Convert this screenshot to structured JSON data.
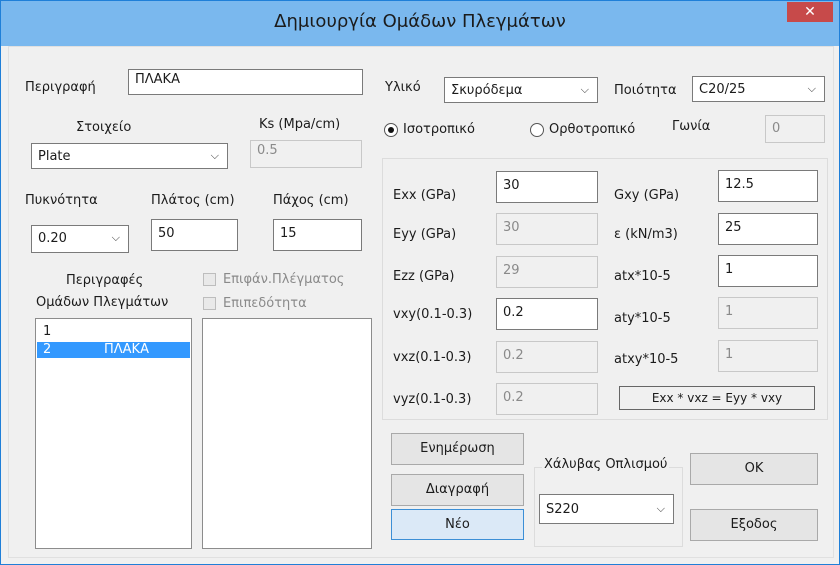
{
  "window": {
    "title": "Δημιουργία Ομάδων Πλεγμάτων",
    "close_label": "✕"
  },
  "description": {
    "label": "Περιγραφή",
    "value": "ΠΛΑΚΑ"
  },
  "element": {
    "label": "Στοιχείο",
    "value": "Plate"
  },
  "ks": {
    "label": "Ks (Mpa/cm)",
    "value": "0.5"
  },
  "density": {
    "label": "Πυκνότητα",
    "value": "0.20"
  },
  "width": {
    "label": "Πλάτος (cm)",
    "value": "50"
  },
  "thickness": {
    "label": "Πάχος (cm)",
    "value": "15"
  },
  "groups": {
    "label1": "Περιγραφές",
    "label2": "Ομάδων Πλεγμάτων",
    "items": [
      {
        "num": "1",
        "name": ""
      },
      {
        "num": "2",
        "name": "ΠΛΑΚΑ"
      }
    ]
  },
  "surface_mesh": {
    "label": "Επιφάν.Πλέγματος"
  },
  "planarity": {
    "label": "Επιπεδότητα"
  },
  "material": {
    "label": "Υλικό",
    "value": "Σκυρόδεμα"
  },
  "quality": {
    "label": "Ποιότητα",
    "value": "C20/25"
  },
  "isotropic": {
    "label": "Ισοτροπικό"
  },
  "orthotropic": {
    "label": "Ορθοτροπικό"
  },
  "angle": {
    "label": "Γωνία",
    "value": "0"
  },
  "props": {
    "exx": {
      "label": "Exx (GPa)",
      "value": "30"
    },
    "eyy": {
      "label": "Eyy (GPa)",
      "value": "30"
    },
    "ezz": {
      "label": "Ezz (GPa)",
      "value": "29"
    },
    "vxy": {
      "label": "vxy(0.1-0.3)",
      "value": "0.2"
    },
    "vxz": {
      "label": "vxz(0.1-0.3)",
      "value": "0.2"
    },
    "vyz": {
      "label": "vyz(0.1-0.3)",
      "value": "0.2"
    },
    "gxy": {
      "label": "Gxy (GPa)",
      "value": "12.5"
    },
    "eps": {
      "label": "ε (kN/m3)",
      "value": "25"
    },
    "atx": {
      "label": "atx*10-5",
      "value": "1"
    },
    "aty": {
      "label": "aty*10-5",
      "value": "1"
    },
    "atxy": {
      "label": "atxy*10-5",
      "value": "1"
    },
    "formula": "Exx * vxz = Eyy * vxy"
  },
  "buttons": {
    "update": "Ενημέρωση",
    "delete": "Διαγραφή",
    "new": "Νέο",
    "ok": "OK",
    "exit": "Εξοδος"
  },
  "steel": {
    "label": "Χάλυβας Οπλισμού",
    "value": "S220"
  }
}
